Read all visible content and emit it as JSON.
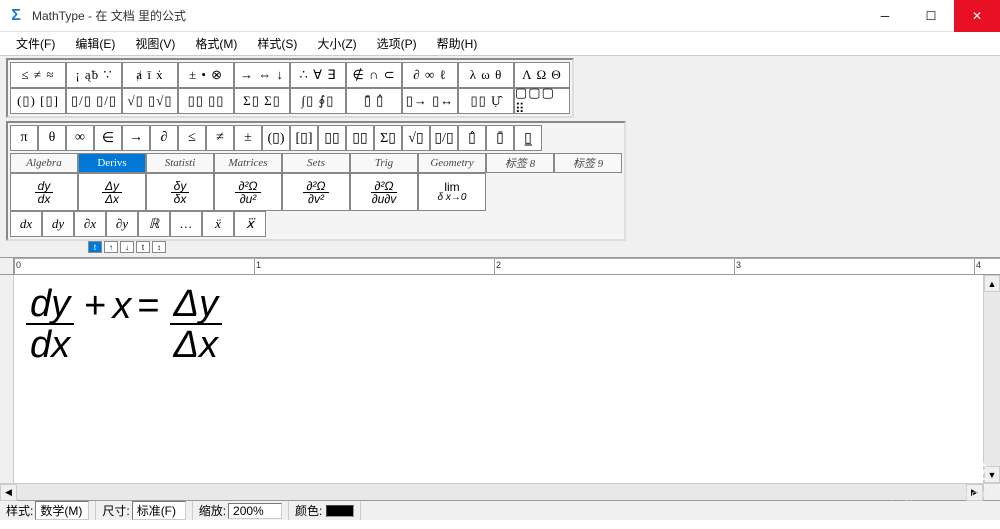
{
  "title": "MathType - 在 文档 里的公式",
  "menus": [
    "文件(F)",
    "编辑(E)",
    "视图(V)",
    "格式(M)",
    "样式(S)",
    "大小(Z)",
    "选项(P)",
    "帮助(H)"
  ],
  "palette": {
    "row1": [
      "≤ ≠ ≈",
      "¡ ąƀ ∵",
      "ⱥ ī ẋ",
      "± • ⊗",
      "→ ⇔ ↓",
      "∴ ∀ ∃",
      "∉ ∩ ⊂",
      "∂ ∞ ℓ",
      "λ ω θ",
      "Λ Ω Θ"
    ],
    "row2": [
      "(▯) [▯]",
      "▯/▯  ▯/▯",
      "√▯ ▯√▯",
      "▯▯ ▯▯",
      "Σ▯ Σ▯",
      "∫▯ ∮▯",
      "▯̄ ▯̂",
      "▯→ ▯↔",
      "▯▯ Ụ̂",
      "▢▢▢ ⠿"
    ]
  },
  "small_row": [
    "π",
    "θ",
    "∞",
    "∈",
    "→",
    "∂",
    "≤",
    "≠",
    "±",
    "(▯)",
    "[▯]",
    "▯▯",
    "▯▯",
    "Σ▯",
    "√▯",
    "▯/▯",
    "▯̂",
    "▯̄",
    "▯̲"
  ],
  "categories": [
    "Algebra",
    "Derivs",
    "Statisti",
    "Matrices",
    "Sets",
    "Trig",
    "Geometry",
    "标签 8",
    "标签 9"
  ],
  "category_active": "Derivs",
  "templates": [
    {
      "num": "dy",
      "den": "dx"
    },
    {
      "num": "Δy",
      "den": "Δx"
    },
    {
      "num": "δy",
      "den": "δx"
    },
    {
      "num": "∂²Ω",
      "den": "∂u²"
    },
    {
      "num": "∂²Ω",
      "den": "∂v²"
    },
    {
      "num": "∂²Ω",
      "den": "∂u∂v"
    },
    {
      "num": "lim",
      "den": "δ x→0"
    }
  ],
  "small_templates": [
    "dx",
    "dy",
    "∂x",
    "∂y",
    "ℝ",
    "…",
    "ẍ",
    "x⃛"
  ],
  "ruler_ticks": [
    "0",
    "1",
    "2",
    "3",
    "4"
  ],
  "equation": {
    "fa_num": "dy",
    "fa_den": "dx",
    "op1": "+",
    "mid": "x",
    "eq": "=",
    "fb_num": "Δy",
    "fb_den": "Δx"
  },
  "status": {
    "style_lbl": "样式:",
    "style_val": "数学(M)",
    "size_lbl": "尺寸:",
    "size_val": "标准(F)",
    "zoom_lbl": "缩放:",
    "zoom_val": "200%",
    "color_lbl": "颜色:"
  },
  "watermark": {
    "brand": "Baidu",
    "cn": "经验",
    "url": "jingyan.baidu.com"
  }
}
